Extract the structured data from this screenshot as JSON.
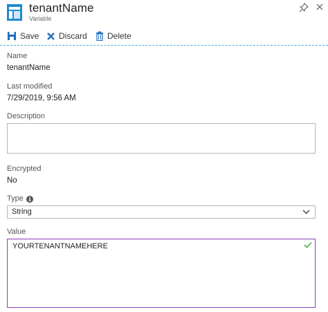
{
  "header": {
    "title": "tenantName",
    "subtitle": "Variable",
    "icon": "variable-icon",
    "accent": "#1e8bd1"
  },
  "toolbar": {
    "save_label": "Save",
    "discard_label": "Discard",
    "delete_label": "Delete"
  },
  "fields": {
    "name_label": "Name",
    "name_value": "tenantName",
    "modified_label": "Last modified",
    "modified_value": "7/29/2019, 9:56 AM",
    "description_label": "Description",
    "description_value": "",
    "encrypted_label": "Encrypted",
    "encrypted_value": "No",
    "type_label": "Type",
    "type_value": "String",
    "value_label": "Value",
    "value_value": "YOURTENANTNAMEHERE"
  },
  "colors": {
    "focus_border": "#8a3ab9",
    "valid_check": "#4caf50",
    "divider": "#4aa6d6"
  }
}
